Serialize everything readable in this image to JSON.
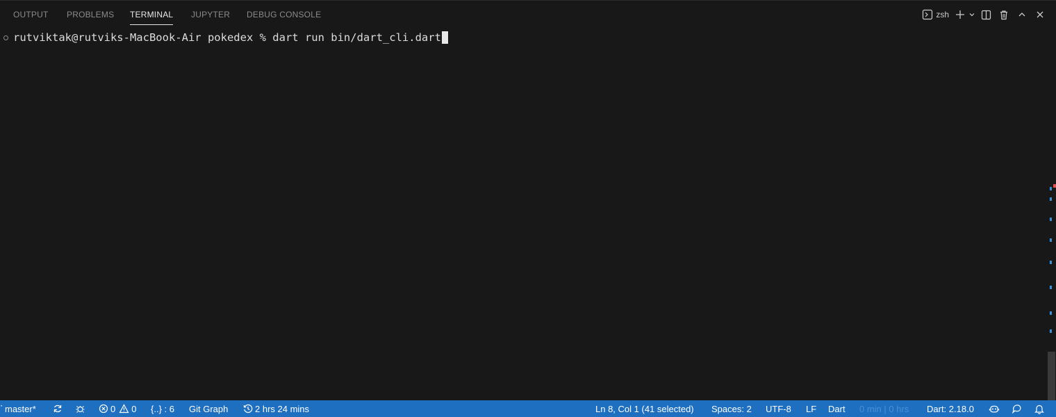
{
  "tabs": [
    {
      "label": "OUTPUT",
      "active": false
    },
    {
      "label": "PROBLEMS",
      "active": false
    },
    {
      "label": "TERMINAL",
      "active": true
    },
    {
      "label": "JUPYTER",
      "active": false
    },
    {
      "label": "DEBUG CONSOLE",
      "active": false
    }
  ],
  "shell": {
    "name": "zsh"
  },
  "terminal": {
    "prompt": "rutviktak@rutviks-MacBook-Air pokedex % ",
    "command": "dart run bin/dart_cli.dart"
  },
  "statusbar": {
    "branch": "master*",
    "errors": "0",
    "warnings": "0",
    "json_outline": "{..} : 6",
    "git_graph": "Git Graph",
    "time": "2 hrs 24 mins",
    "position": "Ln 8, Col 1 (41 selected)",
    "spaces": "Spaces: 2",
    "encoding": "UTF-8",
    "eol": "LF",
    "language": "Dart",
    "timer_faded": "0 min | 0 hrs",
    "dart_version": "Dart: 2.18.0"
  },
  "colors": {
    "statusbar_bg": "#1e6fc0",
    "panel_bg": "#181818",
    "active_tab": "#e7e7e7",
    "inactive_tab": "#8b8b8b"
  }
}
